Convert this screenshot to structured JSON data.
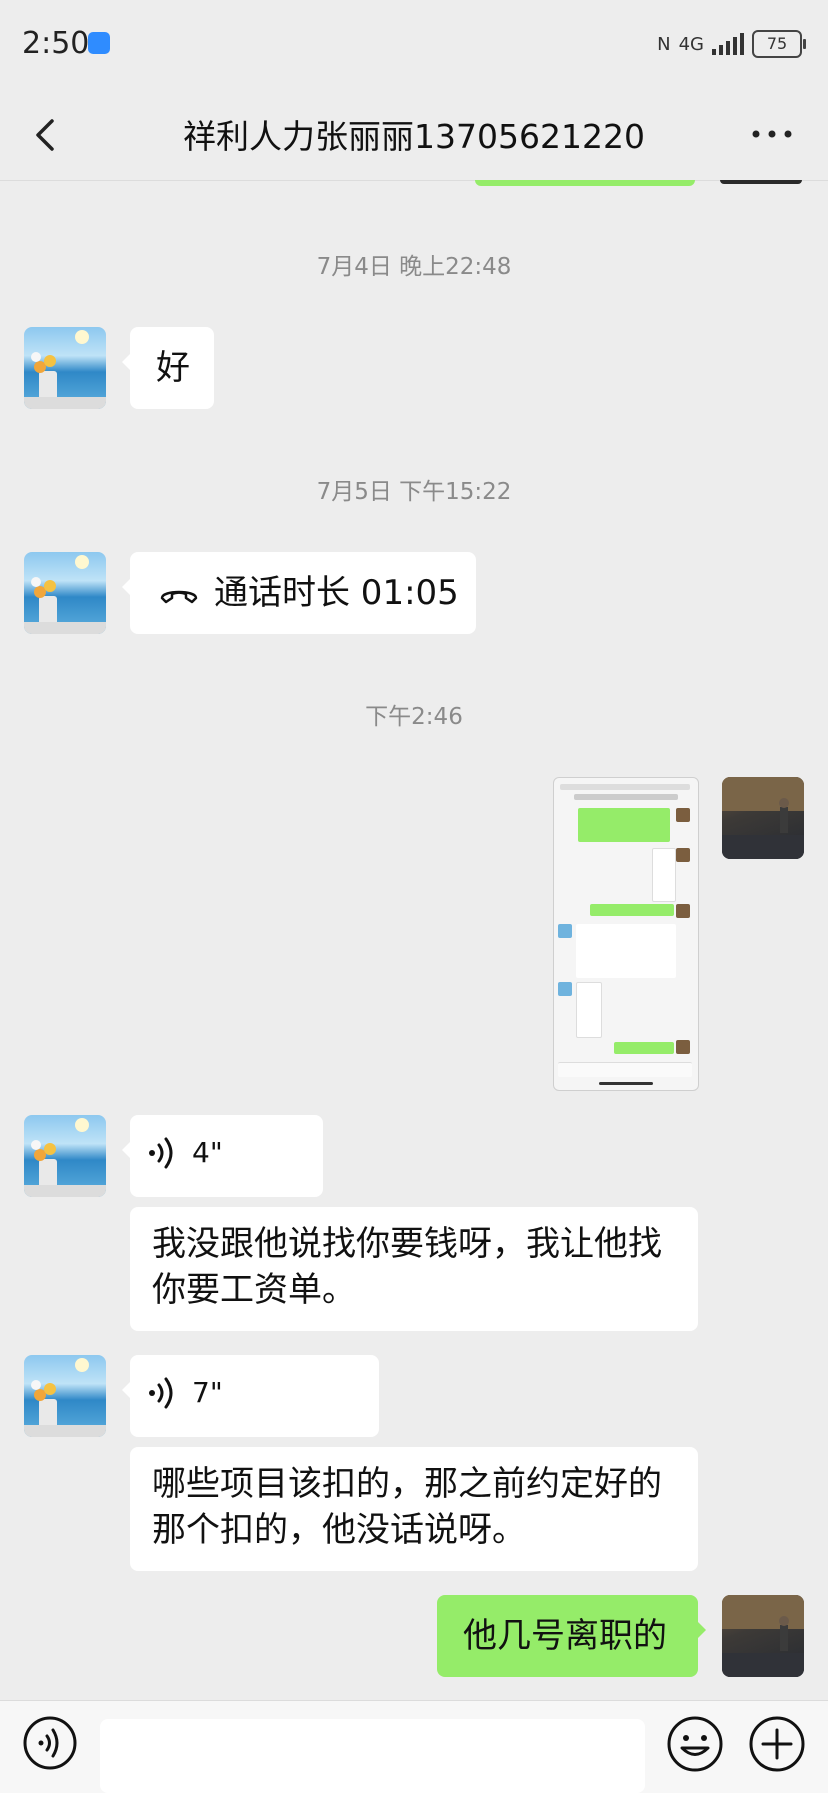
{
  "status_bar": {
    "time": "2:50",
    "network": "4G",
    "battery": "75"
  },
  "header": {
    "title": "祥利人力张丽丽13705621220"
  },
  "messages": {
    "ts1": "7月4日 晚上22:48",
    "msg1": "好",
    "ts2": "7月5日 下午15:22",
    "call_text": "通话时长 01:05",
    "ts3": "下午2:46",
    "voice1_duration": "4\"",
    "transcript1": "我没跟他说找你要钱呀，我让他找你要工资单。",
    "voice2_duration": "7\"",
    "transcript2": "哪些项目该扣的，那之前约定好的那个扣的，他没话说呀。",
    "msg_sent": "他几号离职的"
  },
  "icons": {
    "back": "chevron-left-icon",
    "more": "more-dots-icon",
    "call": "phone-hangup-icon",
    "voice": "voice-wave-icon",
    "emoji": "emoji-icon",
    "plus": "plus-icon"
  },
  "colors": {
    "sent_bubble": "#95ec69",
    "received_bubble": "#ffffff",
    "background": "#ededed"
  }
}
